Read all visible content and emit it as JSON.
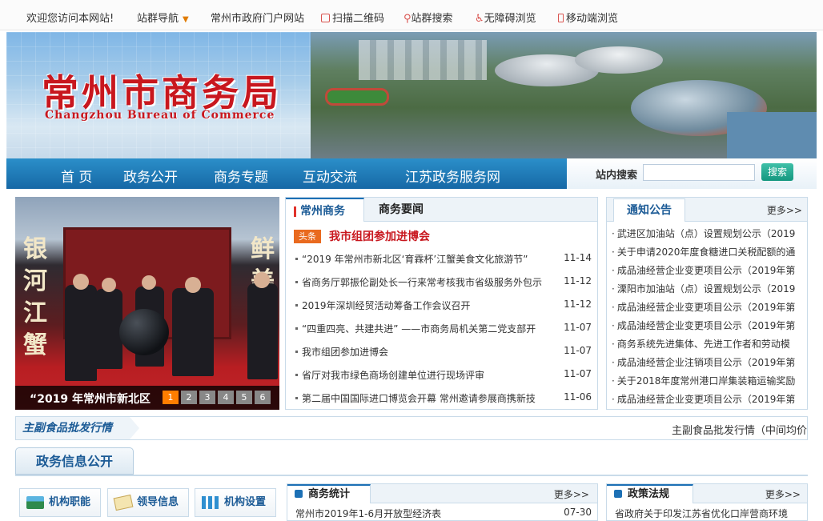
{
  "topbar": {
    "welcome": "欢迎您访问本网站!",
    "site_nav": "站群导航",
    "gov_portal": "常州市政府门户网站",
    "qr": "扫描二维码",
    "site_search": "站群搜索",
    "accessible": "无障碍浏览",
    "mobile": "移动端浏览"
  },
  "banner": {
    "title": "常州市商务局",
    "subtitle": "Changzhou Bureau of Commerce"
  },
  "nav": {
    "items": [
      "首  页",
      "政务公开",
      "商务专题",
      "互动交流",
      "江苏政务服务网"
    ],
    "search_label": "站内搜索",
    "search_placeholder": "",
    "search_button": "搜索"
  },
  "slideshow": {
    "caption": "“2019 年常州市新北区",
    "pages": [
      "1",
      "2",
      "3",
      "4",
      "5",
      "6"
    ],
    "active_page": 1,
    "photo_text_left": [
      "银",
      "河",
      "江",
      "蟹"
    ],
    "photo_text_right": [
      "鲜",
      "美"
    ]
  },
  "news": {
    "tabs": [
      "常州商务",
      "商务要闻"
    ],
    "headline_badge": "头条",
    "headline": "我市组团参加进博会",
    "items": [
      {
        "title": "“2019 年常州市新北区‘育霖杯’江蟹美食文化旅游节”",
        "date": "11-14"
      },
      {
        "title": "省商务厅郭振伦副处长一行来常考核我市省级服务外包示",
        "date": "11-12"
      },
      {
        "title": "2019年深圳经贸活动筹备工作会议召开",
        "date": "11-12"
      },
      {
        "title": "“四重四亮、共建共进” ——市商务局机关第二党支部开",
        "date": "11-07"
      },
      {
        "title": "我市组团参加进博会",
        "date": "11-07"
      },
      {
        "title": "省厅对我市绿色商场创建单位进行现场评审",
        "date": "11-07"
      },
      {
        "title": "第二届中国国际进口博览会开幕 常州邀请参展商携新技",
        "date": "11-06"
      }
    ]
  },
  "notice": {
    "title": "通知公告",
    "more": "更多>>",
    "items": [
      "武进区加油站（点）设置规划公示（2019",
      "关于申请2020年度食糖进口关税配额的通",
      "成品油经营企业变更项目公示（2019年第",
      "溧阳市加油站（点）设置规划公示（2019",
      "成品油经营企业变更项目公示（2019年第",
      "成品油经营企业变更项目公示（2019年第",
      "商务系统先进集体、先进工作者和劳动模",
      "成品油经营企业注销项目公示（2019年第",
      "关于2018年度常州港口岸集装箱运输奖励",
      "成品油经营企业变更项目公示（2019年第"
    ]
  },
  "ticker": {
    "label": "主副食品批发行情",
    "text": "主副食品批发行情（中间均价"
  },
  "gov_info": {
    "title": "政务信息公开",
    "buttons": [
      "机构职能",
      "领导信息",
      "机构设置"
    ]
  },
  "stats_panel": {
    "title": "商务统计",
    "more": "更多>>",
    "item": "常州市2019年1-6月开放型经济表",
    "item_date": "07-30"
  },
  "policy_panel": {
    "title": "政策法规",
    "more": "更多>>",
    "item": "省政府关于印发江苏省优化口岸营商环境"
  },
  "colors": {
    "accent_red": "#c8171e",
    "nav_blue": "#1668a6",
    "link_blue": "#1c5b96",
    "badge_orange": "#e96a1f"
  }
}
